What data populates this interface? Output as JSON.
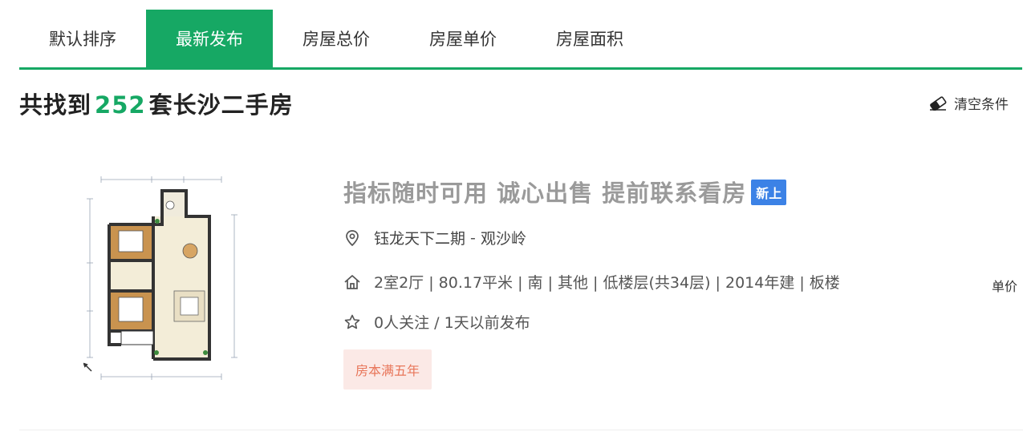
{
  "tabs": [
    {
      "label": "默认排序",
      "active": false
    },
    {
      "label": "最新发布",
      "active": true
    },
    {
      "label": "房屋总价",
      "active": false
    },
    {
      "label": "房屋单价",
      "active": false
    },
    {
      "label": "房屋面积",
      "active": false
    }
  ],
  "result": {
    "prefix": "共找到",
    "count": "252",
    "suffix": "套长沙二手房"
  },
  "clear_filter": {
    "label": "清空条件",
    "icon": "eraser-icon"
  },
  "listing": {
    "title": "指标随时可用 诚心出售 提前联系看房",
    "badge": "新上",
    "community": "钰龙天下二期",
    "separator": " - ",
    "district": "观沙岭",
    "house_info": "2室2厅 | 80.17平米 | 南 | 其他 | 低楼层(共34层) | 2014年建 | 板楼",
    "follow_info": "0人关注 / 1天以前发布",
    "tag": "房本满五年",
    "unit_price_label": "单价",
    "icons": {
      "location": "location-pin-icon",
      "house": "house-icon",
      "follow": "star-icon"
    }
  },
  "colors": {
    "accent": "#16a864",
    "badge": "#3c82e6",
    "tag_bg": "#fbe9e6",
    "tag_text": "#e8765a"
  }
}
